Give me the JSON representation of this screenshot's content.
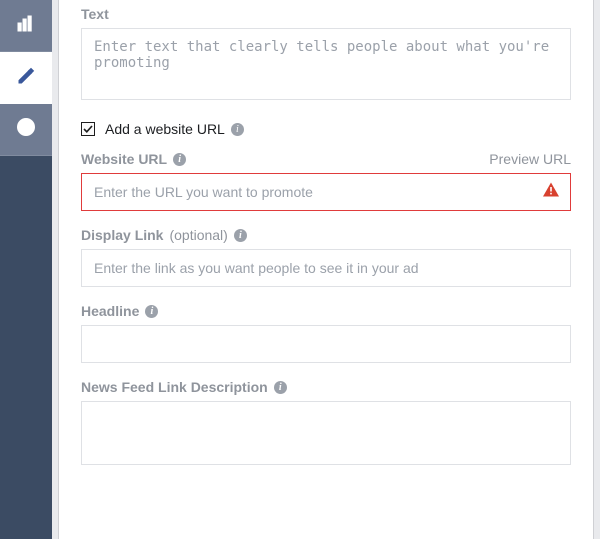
{
  "sidebar": {
    "items": [
      {
        "name": "bar-chart-icon"
      },
      {
        "name": "pencil-icon"
      },
      {
        "name": "clock-icon"
      }
    ],
    "active_index": 1
  },
  "form": {
    "text": {
      "label": "Text",
      "placeholder": "Enter text that clearly tells people about what you're promoting",
      "value": ""
    },
    "add_url": {
      "label": "Add a website URL",
      "checked": true
    },
    "website_url": {
      "label": "Website URL",
      "preview_label": "Preview URL",
      "placeholder": "Enter the URL you want to promote",
      "value": "",
      "error": true
    },
    "display_link": {
      "label": "Display Link",
      "optional": "(optional)",
      "placeholder": "Enter the link as you want people to see it in your ad",
      "value": ""
    },
    "headline": {
      "label": "Headline",
      "placeholder": "",
      "value": ""
    },
    "nf_desc": {
      "label": "News Feed Link Description",
      "placeholder": "",
      "value": ""
    }
  }
}
